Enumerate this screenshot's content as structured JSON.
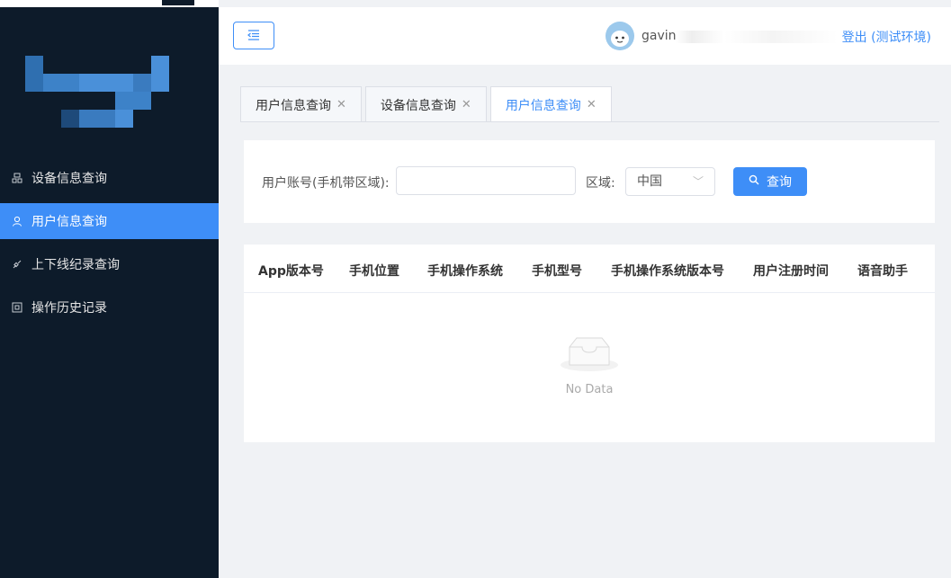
{
  "sidebar": {
    "items": [
      {
        "label": "设备信息查询",
        "icon": "device-icon",
        "active": false
      },
      {
        "label": "用户信息查询",
        "icon": "user-icon",
        "active": true
      },
      {
        "label": "上下线纪录查询",
        "icon": "link-icon",
        "active": false
      },
      {
        "label": "操作历史记录",
        "icon": "history-icon",
        "active": false
      }
    ]
  },
  "header": {
    "username": "gavin",
    "logout": "登出 (测试环境)"
  },
  "tabs": [
    {
      "label": "用户信息查询",
      "active": false
    },
    {
      "label": "设备信息查询",
      "active": false
    },
    {
      "label": "用户信息查询",
      "active": true
    }
  ],
  "search": {
    "account_label": "用户账号(手机带区域):",
    "account_value": "",
    "region_label": "区域:",
    "region_value": "中国",
    "query_label": "查询"
  },
  "table": {
    "columns": [
      "App版本号",
      "手机位置",
      "手机操作系统",
      "手机型号",
      "手机操作系统版本号",
      "用户注册时间",
      "语音助手"
    ],
    "empty_text": "No Data"
  },
  "colors": {
    "accent": "#3e8ef7",
    "sidebar_bg": "#0d1b2a"
  }
}
